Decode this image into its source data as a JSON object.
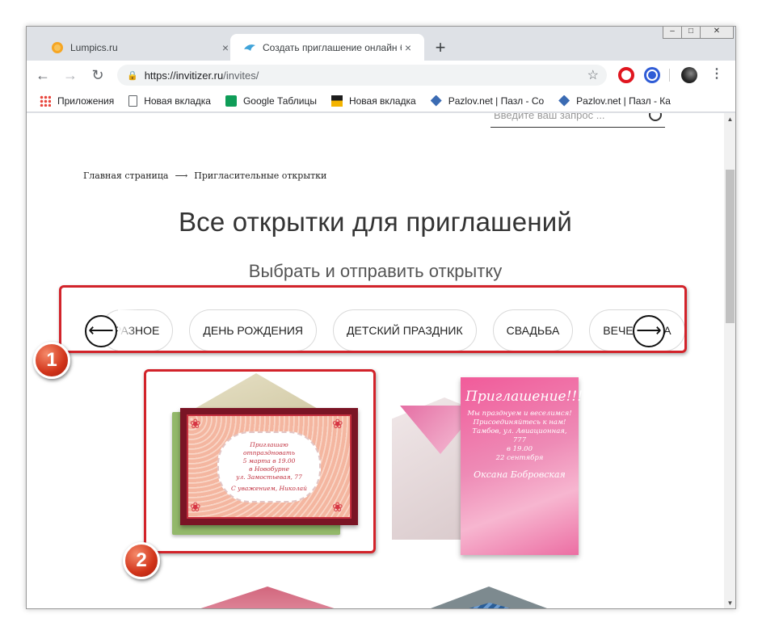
{
  "tabs": [
    {
      "title": "Lumpics.ru",
      "close": "×"
    },
    {
      "title": "Создать приглашение онлайн б",
      "close": "×"
    }
  ],
  "new_tab_symbol": "+",
  "window_controls": {
    "minimize": "–",
    "maximize": "□",
    "close": "✕"
  },
  "toolbar": {
    "back": "←",
    "forward": "→",
    "reload": "↻",
    "url_host": "https://invitizer.ru",
    "url_path": "/invites/",
    "star": "☆",
    "menu": "⋮"
  },
  "bookmarks": [
    {
      "label": "Приложения",
      "icon": "apps-icon"
    },
    {
      "label": "Новая вкладка",
      "icon": "page-icon"
    },
    {
      "label": "Google Таблицы",
      "icon": "sheets-icon"
    },
    {
      "label": "Новая вкладка",
      "icon": "picture-icon"
    },
    {
      "label": "Pazlov.net | Пазл - Со",
      "icon": "puzzle-icon"
    },
    {
      "label": "Pazlov.net | Пазл - Ка",
      "icon": "puzzle-icon"
    }
  ],
  "page": {
    "search_placeholder": "Введите ваш запрос ...",
    "breadcrumb_home": "Главная страница",
    "breadcrumb_arrow": "⟶",
    "breadcrumb_current": "Пригласительные открытки",
    "heading": "Все открытки для приглашений",
    "subheading": "Выбрать и отправить открытку",
    "categories": [
      "РАЗНОЕ",
      "ДЕНЬ РОЖДЕНИЯ",
      "ДЕТСКИЙ ПРАЗДНИК",
      "СВАДЬБА",
      "ВЕЧЕРИНКА"
    ],
    "prev_arrow": "⟵",
    "next_arrow": "⟶"
  },
  "card1": {
    "lines": [
      "Приглашаю",
      "отпраздновать",
      "5 марта в 19.00",
      "в Новобурне",
      "ул. Замостьевая, 77",
      "С уважением, Николай"
    ]
  },
  "card2": {
    "title": "Приглашение!!!",
    "lines": [
      "Мы празднуем и веселимся!",
      "Присоединяйтесь к нам!",
      "Тамбов, ул. Авиационная, 777",
      "в 19.00",
      "22 сентября"
    ],
    "signature": "Оксана Бобровская"
  },
  "callouts": [
    "1",
    "2"
  ],
  "colors": {
    "highlight": "#d2232a",
    "callout": "#d1341a"
  }
}
